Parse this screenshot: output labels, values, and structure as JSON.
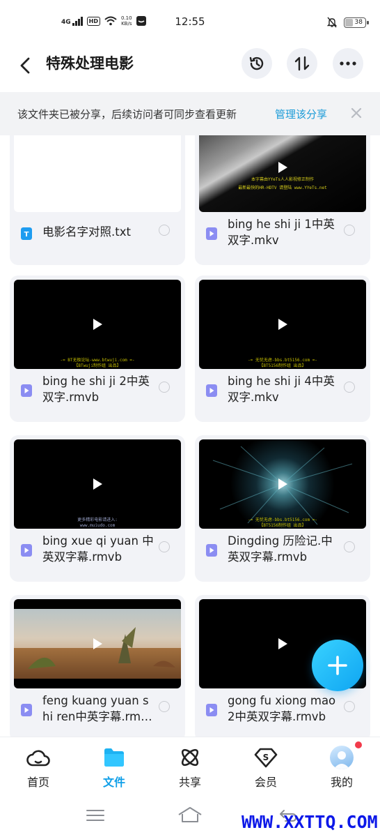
{
  "status_bar": {
    "network": "4G",
    "hd": "HD",
    "speed": "0.10",
    "speed_unit": "KB/s",
    "time": "12:55",
    "battery": "38"
  },
  "header": {
    "title": "特殊处理电影",
    "back_icon": "chevron-left-icon",
    "history_icon": "history-icon",
    "sort_icon": "sort-icon",
    "more_icon": "more-icon"
  },
  "banner": {
    "text": "该文件夹已被分享，后续访问者可同步查看更新",
    "link": "管理该分享",
    "close_icon": "close-icon"
  },
  "files": [
    {
      "name": "电影名字对照.txt",
      "type": "txt"
    },
    {
      "name": "bing he shi ji 1中英双字.mkv",
      "type": "video",
      "subtitle_1": "本字幕由YYeTs人人影视修正制作",
      "subtitle_2": "最新最快的HR-HDTV 请登陆 www.YYeTs.net"
    },
    {
      "name": "bing he shi ji 2中英双字.rmvb",
      "type": "video",
      "subtitle_1": "-= BT无极论坛-www.btwuji.com =-",
      "subtitle_2": "【BTwuji制作组 出品】"
    },
    {
      "name": "bing he shi ji 4中英双字.mkv",
      "type": "video",
      "subtitle_1": "-= 无忧无虑-bbs.bt5156.com =-",
      "subtitle_2": "【BT5156制作组 出品】"
    },
    {
      "name": "bing xue qi yuan 中英双字幕.rmvb",
      "type": "video",
      "subtitle_1": "更多精彩电影请进入:",
      "subtitle_2": "www.muiudo.com"
    },
    {
      "name": "Dingding 历险记.中英双字幕.rmvb",
      "type": "video",
      "subtitle_1": "-= 无忧无虑-bbs.bt5156.com =-",
      "subtitle_2": "【BT5156制作组 出品】"
    },
    {
      "name": "feng kuang yuan shi ren中英字幕.rmvb",
      "type": "video"
    },
    {
      "name": "gong fu xiong mao2中英双字幕.rmvb",
      "type": "video"
    }
  ],
  "fab": {
    "icon": "plus-icon"
  },
  "bottom_nav": {
    "items": [
      {
        "label": "首页",
        "icon": "cloud-home-icon"
      },
      {
        "label": "文件",
        "icon": "folder-icon"
      },
      {
        "label": "共享",
        "icon": "atom-share-icon"
      },
      {
        "label": "会员",
        "icon": "vip-diamond-icon"
      },
      {
        "label": "我的",
        "icon": "avatar-icon"
      }
    ],
    "active": "文件"
  },
  "watermark": "WWW.XXTTQ.COM",
  "colors": {
    "accent": "#0f9fe8",
    "banner_link": "#1b9bd8",
    "fab": "#1fb5f6",
    "card_bg": "#f2f3f7",
    "notification_dot": "#f23b4b",
    "watermark": "#0d19e8"
  }
}
